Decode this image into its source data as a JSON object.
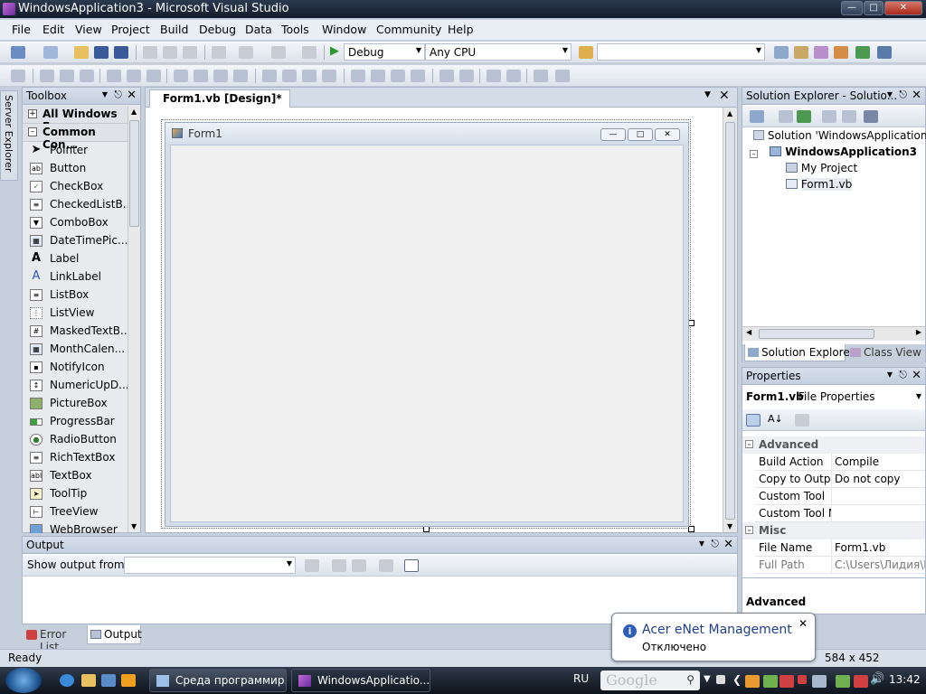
{
  "window": {
    "title": "WindowsApplication3 - Microsoft Visual Studio"
  },
  "menu": [
    "File",
    "Edit",
    "View",
    "Project",
    "Build",
    "Debug",
    "Data",
    "Tools",
    "Window",
    "Community",
    "Help"
  ],
  "toolbar": {
    "config": "Debug",
    "platform": "Any CPU"
  },
  "server_explorer": {
    "label": "Server Explorer"
  },
  "toolbox": {
    "title": "Toolbox",
    "groups": [
      "All Windows F...",
      "Common Con..."
    ],
    "items": [
      "Pointer",
      "Button",
      "CheckBox",
      "CheckedListB...",
      "ComboBox",
      "DateTimePic...",
      "Label",
      "LinkLabel",
      "ListBox",
      "ListView",
      "MaskedTextB...",
      "MonthCalen...",
      "NotifyIcon",
      "NumericUpD...",
      "PictureBox",
      "ProgressBar",
      "RadioButton",
      "RichTextBox",
      "TextBox",
      "ToolTip",
      "TreeView",
      "WebBrowser"
    ]
  },
  "designer": {
    "tab": "Form1.vb [Design]*",
    "form_title": "Form1"
  },
  "solution_explorer": {
    "title": "Solution Explorer - Solutio...",
    "solution": "Solution 'WindowsApplication3'",
    "project": "WindowsApplication3",
    "items": [
      "My Project",
      "Form1.vb"
    ],
    "tabs": [
      "Solution Explorer",
      "Class View"
    ]
  },
  "properties": {
    "title": "Properties",
    "object": "Form1.vb",
    "object_type": "File Properties",
    "categories": [
      {
        "name": "Advanced",
        "rows": [
          {
            "key": "Build Action",
            "value": "Compile"
          },
          {
            "key": "Copy to Output",
            "value": "Do not copy"
          },
          {
            "key": "Custom Tool",
            "value": ""
          },
          {
            "key": "Custom Tool N",
            "value": ""
          }
        ]
      },
      {
        "name": "Misc",
        "rows": [
          {
            "key": "File Name",
            "value": "Form1.vb"
          },
          {
            "key": "Full Path",
            "value": "C:\\Users\\Лидия\\Do"
          }
        ]
      }
    ],
    "description": "Advanced"
  },
  "output": {
    "title": "Output",
    "show_label": "Show output from:",
    "show_value": ""
  },
  "bottom_tabs": [
    "Error List",
    "Output"
  ],
  "status": {
    "left": "Ready",
    "size": "584 x 452"
  },
  "balloon": {
    "title": "Acer eNet Management",
    "text": "Отключено"
  },
  "taskbar": {
    "tasks": [
      "Среда программир...",
      "WindowsApplicatio..."
    ],
    "lang": "RU",
    "clock": "13:42",
    "search_placeholder": "Google"
  }
}
